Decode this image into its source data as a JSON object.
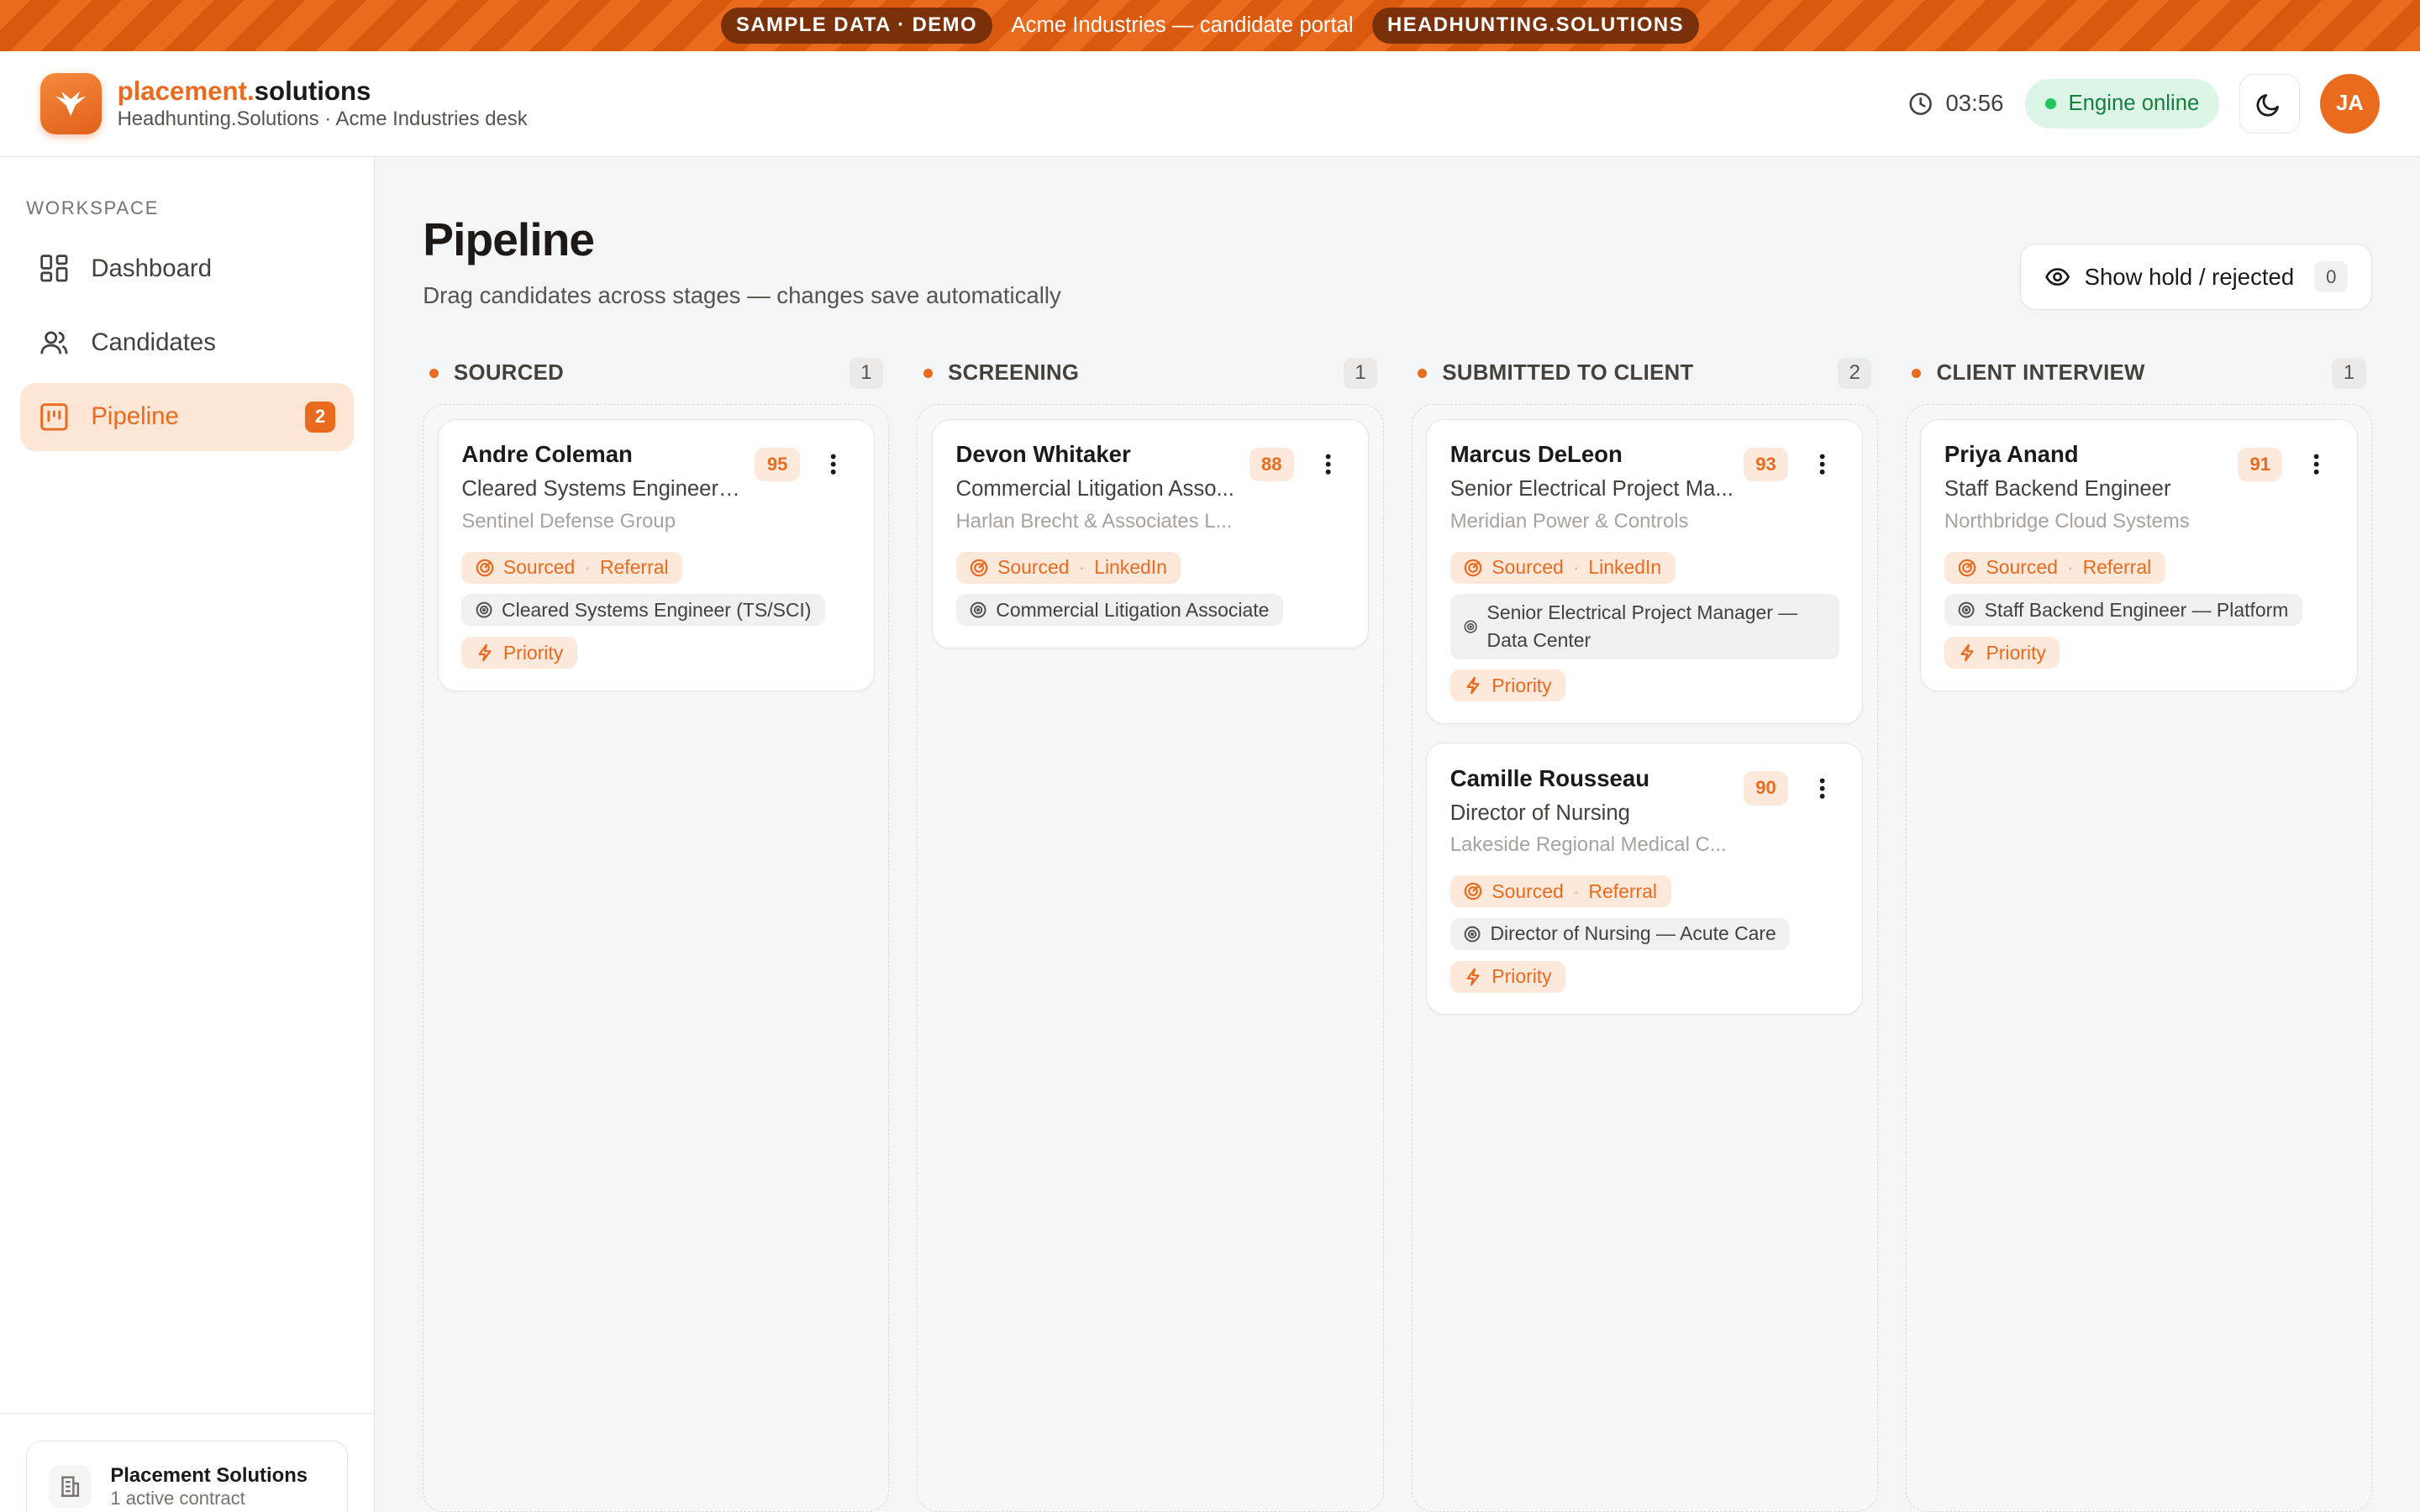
{
  "banner": {
    "badge_left": "SAMPLE DATA · DEMO",
    "text": "Acme Industries — candidate portal",
    "badge_right": "HEADHUNTING.SOLUTIONS"
  },
  "header": {
    "brand_a": "placement.",
    "brand_b": "solutions",
    "subtitle": "Headhunting.Solutions · Acme Industries desk",
    "clock": "03:56",
    "status": "Engine online",
    "avatar": "JA"
  },
  "sidebar": {
    "section": "WORKSPACE",
    "items": [
      {
        "label": "Dashboard",
        "icon": "grid-icon"
      },
      {
        "label": "Candidates",
        "icon": "users-icon"
      },
      {
        "label": "Pipeline",
        "icon": "kanban-icon",
        "badge": "2",
        "active": true
      }
    ],
    "org_name": "Placement Solutions",
    "org_sub": "1 active contract"
  },
  "page": {
    "title": "Pipeline",
    "subtitle": "Drag candidates across stages — changes save automatically",
    "show_button": "Show hold / rejected",
    "show_count": "0"
  },
  "columns": [
    {
      "title": "SOURCED",
      "count": "1",
      "cards": [
        {
          "name": "Andre Coleman",
          "title": "Cleared Systems Engineer (T...",
          "company": "Sentinel Defense Group",
          "score": "95",
          "source": "Sourced",
          "channel": "Referral",
          "role": "Cleared Systems Engineer (TS/SCI)",
          "priority": "Priority"
        }
      ]
    },
    {
      "title": "SCREENING",
      "count": "1",
      "cards": [
        {
          "name": "Devon Whitaker",
          "title": "Commercial Litigation Asso...",
          "company": "Harlan Brecht & Associates L...",
          "score": "88",
          "source": "Sourced",
          "channel": "LinkedIn",
          "role": "Commercial Litigation Associate"
        }
      ]
    },
    {
      "title": "SUBMITTED TO CLIENT",
      "count": "2",
      "cards": [
        {
          "name": "Marcus DeLeon",
          "title": "Senior Electrical Project Ma...",
          "company": "Meridian Power & Controls",
          "score": "93",
          "source": "Sourced",
          "channel": "LinkedIn",
          "role": "Senior Electrical Project Manager — Data Center",
          "priority": "Priority"
        },
        {
          "name": "Camille Rousseau",
          "title": "Director of Nursing",
          "company": "Lakeside Regional Medical C...",
          "score": "90",
          "source": "Sourced",
          "channel": "Referral",
          "role": "Director of Nursing — Acute Care",
          "priority": "Priority"
        }
      ]
    },
    {
      "title": "CLIENT INTERVIEW",
      "count": "1",
      "cards": [
        {
          "name": "Priya Anand",
          "title": "Staff Backend Engineer",
          "company": "Northbridge Cloud Systems",
          "score": "91",
          "source": "Sourced",
          "channel": "Referral",
          "role": "Staff Backend Engineer — Platform",
          "priority": "Priority"
        }
      ]
    }
  ]
}
